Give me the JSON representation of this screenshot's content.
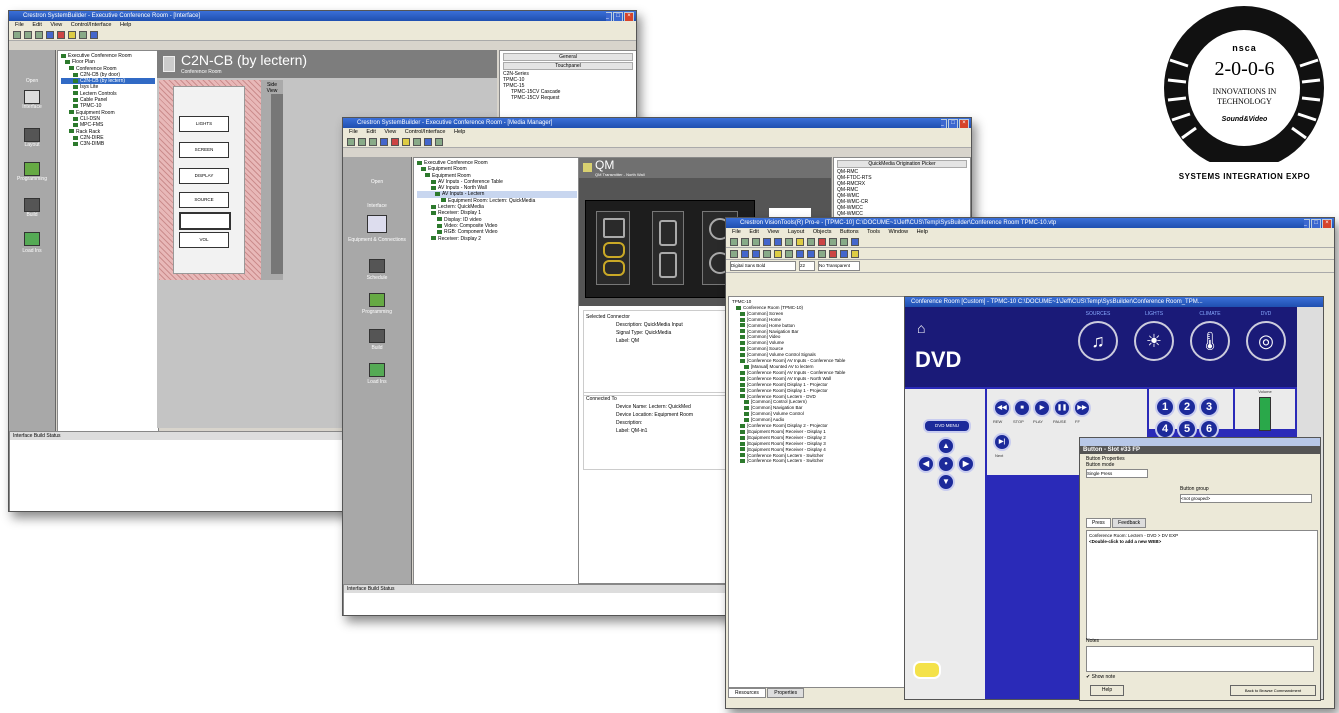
{
  "window1": {
    "title": "Crestron SystemBuilder - Executive Conference Room - [Interface]",
    "menu": [
      "File",
      "Edit",
      "View",
      "Control/Interface",
      "Help"
    ],
    "sidebar": [
      "Open",
      "Interface",
      "Layout",
      "Programming",
      "Build",
      "Load Ins"
    ],
    "tree": [
      "Executive Conference Room",
      "Floor Plan",
      "Conference Room",
      "C2N-CB (by door)",
      "C2N-CB (by lectern)",
      "Isys Lite",
      "Lectern Controls",
      "Cable Panel",
      "TPMC-10",
      "Equipment Room",
      "CLI-DSN",
      "MPC-FMS",
      "Rack Rack",
      "C2N-DIRE",
      "C3N-DIMB"
    ],
    "canvas_title": "C2N-CB (by lectern)",
    "canvas_subtitle": "Conference Room",
    "buttons": [
      "LIGHTS",
      "SCREEN",
      "DISPLAY",
      "SOURCE",
      "",
      "VOL"
    ],
    "side_label": "Side\nView",
    "right_header": "General",
    "right_tab": "Touchpanel",
    "right_items": [
      "C2N-Series",
      "TPMC-10",
      "TPMC-15",
      "TPMC-15CV Cascade",
      "TPMC-15CV Request"
    ],
    "status_label": "Interface Build Status"
  },
  "window2": {
    "title": "Crestron SystemBuilder - Executive Conference Room - [Media Manager]",
    "menu": [
      "File",
      "Edit",
      "View",
      "Control/Interface",
      "Help"
    ],
    "sidebar": [
      "Open",
      "Interface",
      "Equipment & Connections",
      "Schedule",
      "Programming",
      "Build",
      "Load Ins"
    ],
    "tree": [
      "Executive Conference Room",
      "Equipment Room",
      "Equipment Room",
      "AV Inputs - Conference Table",
      "AV Inputs - North Wall",
      "AV Inputs - Lectern",
      "Equipment Room: Lectern: QuickMedia",
      "Lectern: QuickMedia",
      "Receiver: Display 1",
      "Display: ID video",
      "Video: Composite Video",
      "RGB: Component Video",
      "Receiver: Display 2"
    ],
    "device_title": "QM",
    "device_subtitle": "QM Transmitter - North Wall",
    "right_header": "QuickMedia Origination Picker",
    "right_items": [
      "QM-RMC",
      "QM-FTDC-RTS",
      "QM-RMCRX",
      "QM-RMC",
      "QM-WMC",
      "QM-WMC-CR",
      "QM-WMCC",
      "QM-WMCC"
    ],
    "details": [
      {
        "k": "Description",
        "v": "QuickMedia Input"
      },
      {
        "k": "Signal Type",
        "v": "QuickMedia"
      },
      {
        "k": "Label",
        "v": "QM"
      }
    ],
    "connected_title": "Connected To",
    "connected": [
      {
        "k": "Device Name",
        "v": "Lectern: QuickMed"
      },
      {
        "k": "Device Location",
        "v": "Equipment Room"
      },
      {
        "k": "Description",
        "v": ""
      },
      {
        "k": "Label",
        "v": "QM-in1"
      }
    ],
    "selected_title": "Selected Connector",
    "status_label": "Interface Build Status"
  },
  "window3": {
    "title": "Crestron VisionTools(R) Pro-e - [TPMC-10] C:\\DOCUME~1\\Jeff\\CUS\\Temp\\SysBuilder\\Conference Room TPMC-10.vtp",
    "menu": [
      "File",
      "Edit",
      "View",
      "Layout",
      "Objects",
      "Buttons",
      "Tools",
      "Window",
      "Help"
    ],
    "font_select": "Digital Sans Bold",
    "size_select": "22",
    "transparent_label": "No Transparent",
    "panel_title": "Conference Room [Custom] - TPMC-10 C:\\DOCUME~1\\Jeff\\CUS\\Temp\\SysBuilder\\Conference Room_TPM...",
    "tree": [
      "TPMC-10",
      "Conference Room (TPMC-10)",
      "[Common] Screen",
      "[Common] Home",
      "[Common] Home button",
      "[Common] Navigation Bar",
      "[Common] Video",
      "[Common] Volume",
      "[Common] Source",
      "[Common] Volume Control Signals",
      "[Conference Room] AV Inputs - Conference Table",
      "[Manual] Mounted AV to lectern",
      "[Conference Room] AV Inputs - Conference Table",
      "[Conference Room] AV Inputs - North Wall",
      "[Conference Room] Display 1 - Projector",
      "[Conference Room] Display 1 - Projector",
      "[Conference Room] Lectern - DVD",
      "[Common] Control (Lectern)",
      "[Common] Navigation Bar",
      "[Common] Volume Control",
      "[Common] Audio",
      "[Conference Room] Display 2 - Projector",
      "[Equipment Room] Receiver - Display 1",
      "[Equipment Room] Receiver - Display 2",
      "[Equipment Room] Receiver - Display 3",
      "[Equipment Room] Receiver - Display 4",
      "[Conference Room] Lectern - Switcher",
      "[Conference Room] Lectern - Switcher"
    ],
    "nav": [
      "SOURCES",
      "LIGHTS",
      "CLIMATE",
      "DVD"
    ],
    "screen_label": "DVD",
    "dvd_menu": "DVD MENU",
    "transport": [
      "REW",
      "STOP",
      "PLAY",
      "PAUSE",
      "FF"
    ],
    "keypad": [
      "1",
      "2",
      "3",
      "4",
      "5",
      "6"
    ],
    "volume": "Volume",
    "next": "Next",
    "props_title": "Button - Slot #33 FP",
    "props_section": "Button Properties",
    "props_button_mode": "Button mode",
    "props_select": "Single Press",
    "props_group": "Button group",
    "props_group_value": "<not grouped>",
    "props_tabs": [
      "Press",
      "Feedback"
    ],
    "props_lines": [
      "Conference Room: Lectern - DVD > DV EXP",
      "<Double-click to add a new WEB>"
    ],
    "notes_label": "Notes",
    "show_note": "Show note",
    "help": "Help",
    "done": "Back to Browse Commandment",
    "tabs_bottom": [
      "Resources",
      "Properties"
    ]
  },
  "logo": {
    "org": "nsca",
    "year": "2-0-0-6",
    "line1": "INNOVATIONS IN",
    "line2": "TECHNOLOGY",
    "brand": "Sound&Video",
    "footer": "SYSTEMS INTEGRATION EXPO"
  }
}
